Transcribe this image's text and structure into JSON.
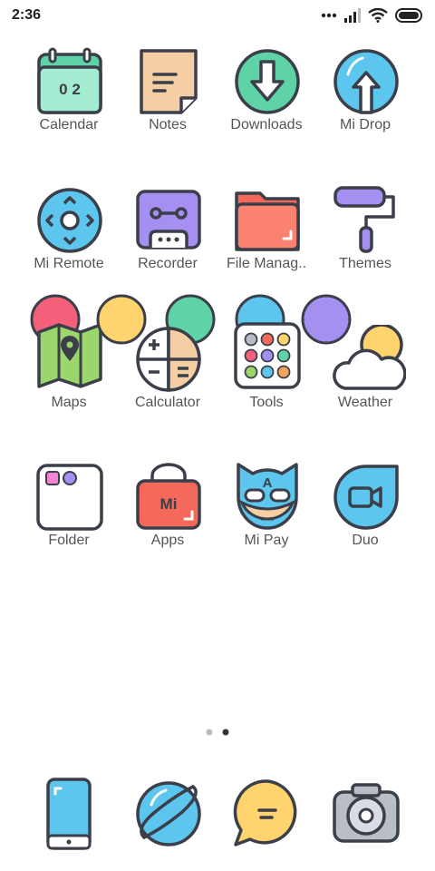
{
  "status_bar": {
    "time": "2:36",
    "icons": [
      "more-dots-icon",
      "signal-icon",
      "wifi-icon",
      "battery-icon"
    ]
  },
  "apps": [
    {
      "label": "Calendar",
      "icon": "calendar-icon",
      "date_text": "0 2"
    },
    {
      "label": "Notes",
      "icon": "notes-icon"
    },
    {
      "label": "Downloads",
      "icon": "downloads-icon"
    },
    {
      "label": "Mi Drop",
      "icon": "mi-drop-icon"
    },
    {
      "label": "Mi Remote",
      "icon": "remote-icon"
    },
    {
      "label": "Recorder",
      "icon": "recorder-icon"
    },
    {
      "label": "File Manag..",
      "icon": "folder-icon"
    },
    {
      "label": "Themes",
      "icon": "paint-roller-icon"
    },
    {
      "label": "Maps",
      "icon": "map-icon"
    },
    {
      "label": "Calculator",
      "icon": "calculator-icon"
    },
    {
      "label": "Tools",
      "icon": "tools-icon"
    },
    {
      "label": "Weather",
      "icon": "weather-icon"
    },
    {
      "label": "Folder",
      "icon": "app-folder-icon"
    },
    {
      "label": "Apps",
      "icon": "app-store-icon",
      "badge_text": "Mi"
    },
    {
      "label": "Mi Pay",
      "icon": "mi-pay-icon",
      "badge_text": "A"
    },
    {
      "label": "Duo",
      "icon": "duo-icon"
    }
  ],
  "page_indicator": {
    "pages": 2,
    "current": 2
  },
  "dock": [
    {
      "icon": "phone-icon"
    },
    {
      "icon": "browser-icon"
    },
    {
      "icon": "messaging-icon"
    },
    {
      "icon": "camera-icon"
    }
  ],
  "colors": {
    "outline": "#3a3f4a",
    "green": "#5fd3a8",
    "blue": "#5cc6ee",
    "peach": "#f5cfa3",
    "purple": "#a58ff0",
    "red": "#f4695a",
    "yellow": "#ffd36e",
    "pink": "#f4607a",
    "lime": "#9ad66b",
    "grey": "#b9bdc4"
  }
}
